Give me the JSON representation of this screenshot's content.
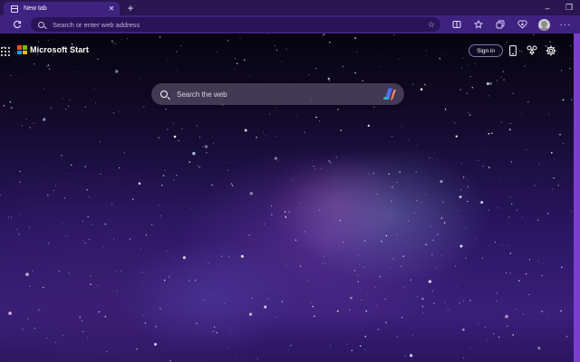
{
  "browser": {
    "tab": {
      "title": "New tab",
      "icon": "new-tab-page-icon"
    },
    "address_bar": {
      "placeholder": "Search or enter web address",
      "value": ""
    },
    "toolbar_icons": [
      "refresh-icon",
      "split-screen-icon",
      "favorites-icon",
      "collections-icon",
      "copilot-heart-icon",
      "profile-avatar",
      "more-menu-icon"
    ],
    "window_controls": [
      "minimize-icon",
      "restore-icon"
    ]
  },
  "page": {
    "brand": "Microsoft Start",
    "sign_in_label": "Sign in",
    "search": {
      "placeholder": "Search the web",
      "value": ""
    },
    "header_icons": [
      "phone-icon",
      "rewards-trophy-icon",
      "settings-gear-icon"
    ],
    "background": "galaxy-starfield"
  },
  "colors": {
    "tabstrip": "#2a1650",
    "toolbar": "#3f2280",
    "omnibox": "#2a1356",
    "accent": "#7b3ed1",
    "ms_red": "#f25022",
    "ms_green": "#7fba00",
    "ms_blue": "#00a4ef",
    "ms_yellow": "#ffb900"
  }
}
